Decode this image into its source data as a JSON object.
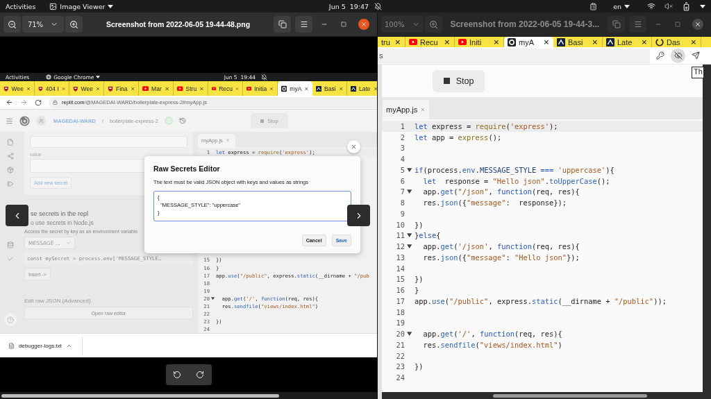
{
  "top_bar": {
    "activities": "Activities",
    "app_menu": "Image Viewer",
    "clock": "Jun 5  19:47",
    "language": "en"
  },
  "left_viewer": {
    "focused": true,
    "zoom": "71%",
    "title": "Screenshot from 2022-06-05 19-44-48.png"
  },
  "right_viewer": {
    "focused": false,
    "zoom": "100%",
    "title": "Screenshot from 2022-06-05 19-44-3..."
  },
  "left_screenshot": {
    "top_bar": {
      "activities": "Activities",
      "app_menu": "Google Chrome",
      "clock": "Jun 5  19:44"
    },
    "tabs": [
      {
        "label": "Wee",
        "kind": "shield",
        "selected": false
      },
      {
        "label": "404 I",
        "kind": "shield",
        "selected": false
      },
      {
        "label": "Wee",
        "kind": "shield",
        "selected": false
      },
      {
        "label": "Fina",
        "kind": "shield",
        "selected": false
      },
      {
        "label": "Mar",
        "kind": "video",
        "selected": false
      },
      {
        "label": "Stru",
        "kind": "video",
        "selected": false
      },
      {
        "label": "Recu",
        "kind": "video",
        "selected": false
      },
      {
        "label": "Initia",
        "kind": "video",
        "selected": false
      },
      {
        "label": "myA",
        "kind": "replit",
        "selected": true
      },
      {
        "label": "Basi",
        "kind": "brackets",
        "selected": false
      },
      {
        "label": "Late",
        "kind": "brackets",
        "selected": false
      }
    ],
    "url_host": "replit.com",
    "url_path": "/@MAGEDAI-WARD/boilerplate-express-2#myApp.js",
    "replit": {
      "user": "MAGEDAI-WARD",
      "separator": "/",
      "repl": "boilerplate-express-2",
      "stop": "Stop"
    },
    "secrets": {
      "value_label": "value",
      "add_button": "Add new secret",
      "heading": "se secrets in the repl",
      "subheading": "o use secrets in Node.js",
      "hint": "Access the secret by key as an environment variable",
      "key_select": "MESSAGE ...",
      "snippet": "const mySecret = process.env['MESSAGE_STYLE…",
      "insert_button": "Insert ->",
      "raw_heading": "Edit raw JSON (Advanced)",
      "raw_button": "Open raw editor"
    },
    "editor": {
      "tab": "myApp.js",
      "lines": [
        {
          "number": "1",
          "foldable": false,
          "active": true,
          "tokens": [
            {
              "kind": "keyword",
              "text": "let"
            },
            {
              "kind": "plain",
              "text": " express = "
            },
            {
              "kind": "call",
              "text": "require"
            },
            {
              "kind": "plain",
              "text": "("
            },
            {
              "kind": "string",
              "text": "'express'"
            },
            {
              "kind": "plain",
              "text": ");"
            }
          ]
        },
        {
          "number": "15",
          "foldable": false,
          "active": false,
          "tokens": [
            {
              "kind": "plain",
              "text": "})"
            }
          ]
        },
        {
          "number": "16",
          "foldable": false,
          "active": false,
          "tokens": [
            {
              "kind": "plain",
              "text": "}"
            }
          ]
        },
        {
          "number": "17",
          "foldable": false,
          "active": false,
          "tokens": [
            {
              "kind": "plain",
              "text": "app."
            },
            {
              "kind": "property",
              "text": "use"
            },
            {
              "kind": "plain",
              "text": "("
            },
            {
              "kind": "string",
              "text": "\"/public\""
            },
            {
              "kind": "plain",
              "text": ", express."
            },
            {
              "kind": "property",
              "text": "static"
            },
            {
              "kind": "plain",
              "text": "(__dirname + "
            },
            {
              "kind": "string",
              "text": "\"/pub"
            }
          ]
        },
        {
          "number": "18",
          "foldable": false,
          "active": false
        },
        {
          "number": "19",
          "foldable": false,
          "active": false
        },
        {
          "number": "20",
          "foldable": true,
          "active": false,
          "tokens": [
            {
              "kind": "plain",
              "text": "  app."
            },
            {
              "kind": "property",
              "text": "get"
            },
            {
              "kind": "plain",
              "text": "("
            },
            {
              "kind": "string",
              "text": "'/'"
            },
            {
              "kind": "plain",
              "text": ", "
            },
            {
              "kind": "keyword",
              "text": "function"
            },
            {
              "kind": "plain",
              "text": "(req, res){"
            }
          ]
        },
        {
          "number": "21",
          "foldable": false,
          "active": false,
          "tokens": [
            {
              "kind": "plain",
              "text": "  res."
            },
            {
              "kind": "property",
              "text": "sendfile"
            },
            {
              "kind": "plain",
              "text": "("
            },
            {
              "kind": "string",
              "text": "\"views/index.html\""
            },
            {
              "kind": "plain",
              "text": ")"
            }
          ]
        },
        {
          "number": "22",
          "foldable": false,
          "active": false
        },
        {
          "number": "23",
          "foldable": false,
          "active": false,
          "tokens": [
            {
              "kind": "plain",
              "text": "})"
            }
          ]
        },
        {
          "number": "24",
          "foldable": false,
          "active": false
        }
      ]
    },
    "modal": {
      "title": "Raw Secrets Editor",
      "text": "The text must be valid JSON object with keys and values as strings",
      "value": "{\n  \"MESSAGE_STYLE\": \"uppercase\"\n}",
      "cancel": "Cancel",
      "save": "Save"
    },
    "download": {
      "file": "debugger-logs.txt"
    }
  },
  "right_screenshot": {
    "tabs": [
      {
        "label": "tru",
        "kind": "none",
        "selected": false
      },
      {
        "label": "Recu",
        "kind": "video",
        "selected": false
      },
      {
        "label": "Initi",
        "kind": "video",
        "selected": false
      },
      {
        "label": "myA",
        "kind": "replit",
        "selected": true
      },
      {
        "label": "Basi",
        "kind": "brackets",
        "selected": false
      },
      {
        "label": "Late",
        "kind": "brackets",
        "selected": false
      },
      {
        "label": "Das",
        "kind": "ring",
        "selected": false
      }
    ],
    "url": "s",
    "tooltip": "Th",
    "stop": "Stop",
    "editor": {
      "tab": "myApp.js",
      "lines": [
        {
          "number": "1",
          "foldable": false,
          "active": true,
          "tokens": [
            {
              "kind": "keyword",
              "text": "let"
            },
            {
              "kind": "plain",
              "text": " express = "
            },
            {
              "kind": "call",
              "text": "require"
            },
            {
              "kind": "plain",
              "text": "("
            },
            {
              "kind": "string",
              "text": "'express'"
            },
            {
              "kind": "plain",
              "text": ");"
            }
          ]
        },
        {
          "number": "2",
          "foldable": false,
          "active": false,
          "tokens": [
            {
              "kind": "keyword",
              "text": "let"
            },
            {
              "kind": "plain",
              "text": " app = "
            },
            {
              "kind": "call",
              "text": "express"
            },
            {
              "kind": "plain",
              "text": "();"
            }
          ]
        },
        {
          "number": "3",
          "foldable": false,
          "active": false
        },
        {
          "number": "4",
          "foldable": false,
          "active": false
        },
        {
          "number": "5",
          "foldable": true,
          "active": false,
          "tokens": [
            {
              "kind": "keyword",
              "text": "if"
            },
            {
              "kind": "plain",
              "text": "(process."
            },
            {
              "kind": "property",
              "text": "env"
            },
            {
              "kind": "plain",
              "text": "."
            },
            {
              "kind": "constant",
              "text": "MESSAGE_STYLE"
            },
            {
              "kind": "keyword",
              "text": " === "
            },
            {
              "kind": "string",
              "text": "'uppercase'"
            },
            {
              "kind": "plain",
              "text": "){"
            }
          ]
        },
        {
          "number": "6",
          "foldable": false,
          "active": false,
          "tokens": [
            {
              "kind": "keyword",
              "text": "  let"
            },
            {
              "kind": "plain",
              "text": "  response = "
            },
            {
              "kind": "string",
              "text": "\"Hello json\""
            },
            {
              "kind": "plain",
              "text": "."
            },
            {
              "kind": "property",
              "text": "toUpperCase"
            },
            {
              "kind": "plain",
              "text": "();"
            }
          ]
        },
        {
          "number": "7",
          "foldable": true,
          "active": false,
          "tokens": [
            {
              "kind": "plain",
              "text": "  app."
            },
            {
              "kind": "property",
              "text": "get"
            },
            {
              "kind": "plain",
              "text": "("
            },
            {
              "kind": "string",
              "text": "\"/json\""
            },
            {
              "kind": "plain",
              "text": ", "
            },
            {
              "kind": "keyword",
              "text": "function"
            },
            {
              "kind": "plain",
              "text": "(req, res){"
            }
          ]
        },
        {
          "number": "8",
          "foldable": false,
          "active": false,
          "tokens": [
            {
              "kind": "plain",
              "text": "  res."
            },
            {
              "kind": "property",
              "text": "json"
            },
            {
              "kind": "plain",
              "text": "({"
            },
            {
              "kind": "string",
              "text": "\"message\""
            },
            {
              "kind": "plain",
              "text": ":  response});"
            }
          ]
        },
        {
          "number": "9",
          "foldable": false,
          "active": false
        },
        {
          "number": "10",
          "foldable": false,
          "active": false,
          "tokens": [
            {
              "kind": "plain",
              "text": "})"
            }
          ]
        },
        {
          "number": "11",
          "foldable": true,
          "active": false,
          "tokens": [
            {
              "kind": "plain",
              "text": "}"
            },
            {
              "kind": "keyword",
              "text": "else"
            },
            {
              "kind": "plain",
              "text": "{"
            }
          ]
        },
        {
          "number": "12",
          "foldable": true,
          "active": false,
          "tokens": [
            {
              "kind": "plain",
              "text": "  app."
            },
            {
              "kind": "property",
              "text": "get"
            },
            {
              "kind": "plain",
              "text": "("
            },
            {
              "kind": "string",
              "text": "'/json'"
            },
            {
              "kind": "plain",
              "text": ", "
            },
            {
              "kind": "keyword",
              "text": "function"
            },
            {
              "kind": "plain",
              "text": "(req, res){"
            }
          ]
        },
        {
          "number": "13",
          "foldable": false,
          "active": false,
          "tokens": [
            {
              "kind": "plain",
              "text": "  res."
            },
            {
              "kind": "property",
              "text": "json"
            },
            {
              "kind": "plain",
              "text": "({"
            },
            {
              "kind": "string",
              "text": "\"message\""
            },
            {
              "kind": "plain",
              "text": ": "
            },
            {
              "kind": "string",
              "text": "\"Hello json\""
            },
            {
              "kind": "plain",
              "text": "});"
            }
          ]
        },
        {
          "number": "14",
          "foldable": false,
          "active": false
        },
        {
          "number": "15",
          "foldable": false,
          "active": false,
          "tokens": [
            {
              "kind": "plain",
              "text": "})"
            }
          ]
        },
        {
          "number": "16",
          "foldable": false,
          "active": false,
          "tokens": [
            {
              "kind": "plain",
              "text": "}"
            }
          ]
        },
        {
          "number": "17",
          "foldable": false,
          "active": false,
          "tokens": [
            {
              "kind": "plain",
              "text": "app."
            },
            {
              "kind": "property",
              "text": "use"
            },
            {
              "kind": "plain",
              "text": "("
            },
            {
              "kind": "string",
              "text": "\"/public\""
            },
            {
              "kind": "plain",
              "text": ", express."
            },
            {
              "kind": "property",
              "text": "static"
            },
            {
              "kind": "plain",
              "text": "(__dirname + "
            },
            {
              "kind": "string",
              "text": "\"/public\""
            },
            {
              "kind": "plain",
              "text": "));"
            }
          ]
        },
        {
          "number": "18",
          "foldable": false,
          "active": false
        },
        {
          "number": "19",
          "foldable": false,
          "active": false
        },
        {
          "number": "20",
          "foldable": true,
          "active": false,
          "tokens": [
            {
              "kind": "plain",
              "text": "  app."
            },
            {
              "kind": "property",
              "text": "get"
            },
            {
              "kind": "plain",
              "text": "("
            },
            {
              "kind": "string",
              "text": "'/'"
            },
            {
              "kind": "plain",
              "text": ", "
            },
            {
              "kind": "keyword",
              "text": "function"
            },
            {
              "kind": "plain",
              "text": "(req, res){"
            }
          ]
        },
        {
          "number": "21",
          "foldable": false,
          "active": false,
          "tokens": [
            {
              "kind": "plain",
              "text": "  res."
            },
            {
              "kind": "property",
              "text": "sendfile"
            },
            {
              "kind": "plain",
              "text": "("
            },
            {
              "kind": "string",
              "text": "\"views/index.html\""
            },
            {
              "kind": "plain",
              "text": ")"
            }
          ]
        },
        {
          "number": "22",
          "foldable": false,
          "active": false
        },
        {
          "number": "23",
          "foldable": false,
          "active": false,
          "tokens": [
            {
              "kind": "plain",
              "text": "})"
            }
          ]
        },
        {
          "number": "24",
          "foldable": false,
          "active": false
        }
      ]
    }
  }
}
